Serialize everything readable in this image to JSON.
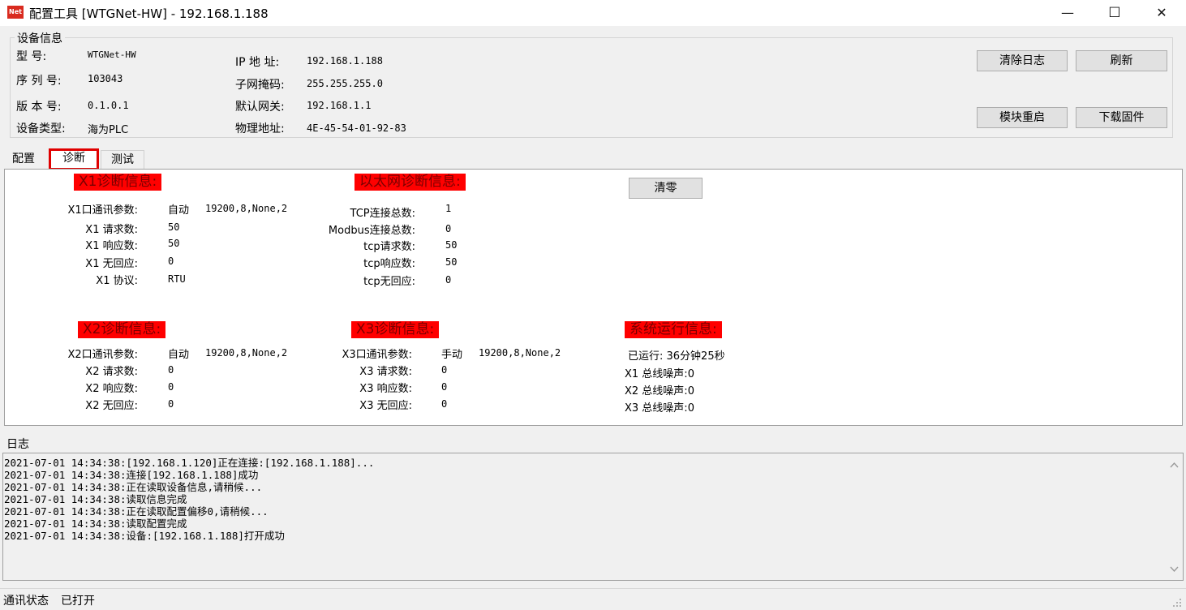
{
  "window": {
    "title": "配置工具 [WTGNet-HW] - 192.168.1.188",
    "icon_text": "Net",
    "minimize": "—",
    "maximize": "☐",
    "close": "✕"
  },
  "device_info": {
    "legend": "设备信息",
    "model_label": "型    号:",
    "model_value": "WTGNet-HW",
    "serial_label": "序 列 号:",
    "serial_value": "103043",
    "version_label": "版 本 号:",
    "version_value": "0.1.0.1",
    "type_label": "设备类型:",
    "type_value": "海为PLC",
    "ip_label": "IP 地 址:",
    "ip_value": "192.168.1.188",
    "mask_label": "子网掩码:",
    "mask_value": "255.255.255.0",
    "gateway_label": "默认网关:",
    "gateway_value": "192.168.1.1",
    "mac_label": "物理地址:",
    "mac_value": "4E-45-54-01-92-83",
    "buttons": {
      "clear_log": "清除日志",
      "refresh": "刷新",
      "reboot": "模块重启",
      "download_fw": "下载固件"
    }
  },
  "tabs": [
    "配置",
    "诊断",
    "测试"
  ],
  "diag": {
    "clear_button": "清零",
    "x1": {
      "header": "X1诊断信息:",
      "param_label": "X1口通讯参数:",
      "param_mode": "自动",
      "param_value": "19200,8,None,2",
      "req_label": "X1 请求数:",
      "req_value": "50",
      "resp_label": "X1 响应数:",
      "resp_value": "50",
      "noresp_label": "X1 无回应:",
      "noresp_value": "0",
      "proto_label": "X1 协议:",
      "proto_value": "RTU"
    },
    "eth": {
      "header": "以太网诊断信息:",
      "tcp_total_label": "TCP连接总数:",
      "tcp_total_value": "1",
      "modbus_total_label": "Modbus连接总数:",
      "modbus_total_value": "0",
      "req_label": "tcp请求数:",
      "req_value": "50",
      "resp_label": "tcp响应数:",
      "resp_value": "50",
      "noresp_label": "tcp无回应:",
      "noresp_value": "0"
    },
    "x2": {
      "header": "X2诊断信息:",
      "param_label": "X2口通讯参数:",
      "param_mode": "自动",
      "param_value": "19200,8,None,2",
      "req_label": "X2 请求数:",
      "req_value": "0",
      "resp_label": "X2 响应数:",
      "resp_value": "0",
      "noresp_label": "X2 无回应:",
      "noresp_value": "0"
    },
    "x3": {
      "header": "X3诊断信息:",
      "param_label": "X3口通讯参数:",
      "param_mode": "手动",
      "param_value": "19200,8,None,2",
      "req_label": "X3 请求数:",
      "req_value": "0",
      "resp_label": "X3 响应数:",
      "resp_value": "0",
      "noresp_label": "X3 无回应:",
      "noresp_value": "0"
    },
    "sys": {
      "header": "系统运行信息:",
      "uptime": "已运行: 36分钟25秒",
      "x1_noise": "X1 总线噪声:0",
      "x2_noise": "X2 总线噪声:0",
      "x3_noise": "X3 总线噪声:0"
    }
  },
  "log": {
    "label": "日志",
    "lines": [
      "2021-07-01 14:34:38:[192.168.1.120]正在连接:[192.168.1.188]...",
      "2021-07-01 14:34:38:连接[192.168.1.188]成功",
      "2021-07-01 14:34:38:正在读取设备信息,请稍候...",
      "2021-07-01 14:34:38:读取信息完成",
      "2021-07-01 14:34:38:正在读取配置偏移0,请稍候...",
      "2021-07-01 14:34:38:读取配置完成",
      "2021-07-01 14:34:38:设备:[192.168.1.188]打开成功"
    ]
  },
  "status": {
    "label": "通讯状态",
    "value": "已打开"
  },
  "colors": {
    "header_bg": "#ff0000",
    "highlight_box": "#e00000"
  }
}
